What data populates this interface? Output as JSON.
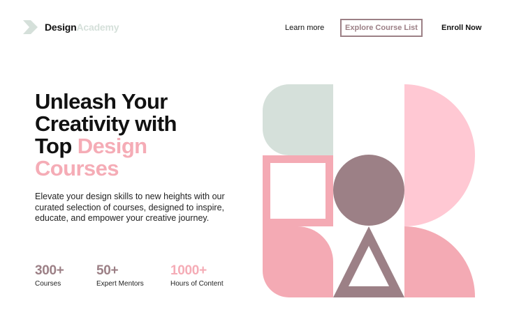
{
  "brand": {
    "name_strong": "Design",
    "name_light": "Academy"
  },
  "nav": {
    "learn_more": "Learn more",
    "explore": "Explore Course List",
    "enroll": "Enroll Now"
  },
  "hero": {
    "title_lines": [
      "Unleash Your",
      "Creativity with",
      "Top"
    ],
    "title_accent_1": "Design",
    "title_accent_2": "Courses",
    "subtitle": "Elevate your design skills to new heights with our curated selection of courses, designed to inspire, educate, and empower your creative journey."
  },
  "stats": [
    {
      "value": "300+",
      "label": "Courses",
      "color": "#9c8086"
    },
    {
      "value": "50+",
      "label": "Expert Mentors",
      "color": "#9c8086"
    },
    {
      "value": "1000+",
      "label": "Hours of Content",
      "color": "#f5acb6"
    }
  ],
  "colors": {
    "mint": "#d5e0da",
    "pink_light": "#ffc8d3",
    "pink": "#f4aab4",
    "mauve": "#9c8086",
    "text": "#111111"
  },
  "icons": {
    "logo": "chevron-logo-icon"
  }
}
